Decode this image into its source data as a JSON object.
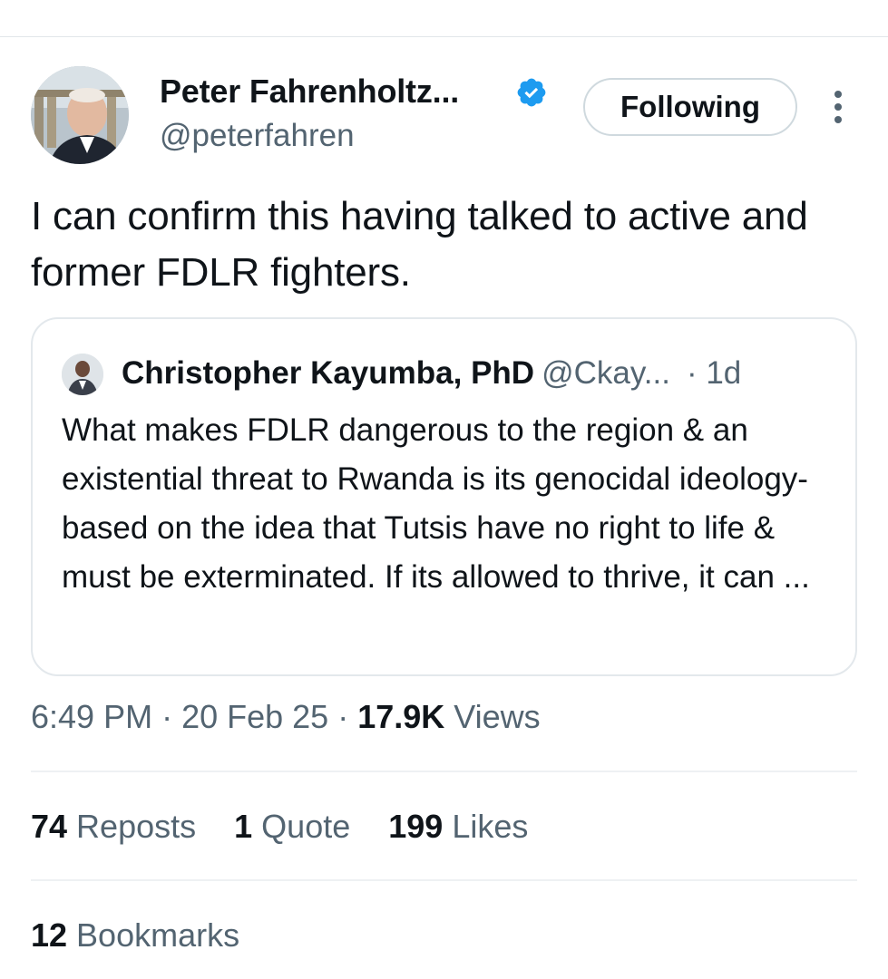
{
  "author": {
    "display_name": "Peter Fahrenholtz...",
    "handle": "@peterfahren",
    "verified": true
  },
  "follow_button_label": "Following",
  "tweet_text": "I can confirm this having talked to active and former FDLR fighters.",
  "quoted_tweet": {
    "display_name": "Christopher Kayumba, PhD",
    "handle": "@Ckay...",
    "time": "· 1d",
    "text": "What makes FDLR dangerous to the region & an existential threat to Rwanda is its genocidal ideology-based on the idea that Tutsis have no right to life & must be exterminated. If its allowed to thrive, it can ..."
  },
  "meta": {
    "time": "6:49 PM",
    "sep1": " · ",
    "date": "20 Feb 25",
    "sep2": " · ",
    "views_count": "17.9K",
    "views_label": " Views"
  },
  "stats": {
    "reposts_count": "74",
    "reposts_label": " Reposts",
    "quotes_count": "1",
    "quotes_label": " Quote",
    "likes_count": "199",
    "likes_label": " Likes"
  },
  "bookmarks": {
    "count": "12",
    "label": " Bookmarks"
  },
  "colors": {
    "verified_blue": "#1d9bf0",
    "text_primary": "#0f1419",
    "text_secondary": "#536471",
    "border": "#cfd9de"
  }
}
